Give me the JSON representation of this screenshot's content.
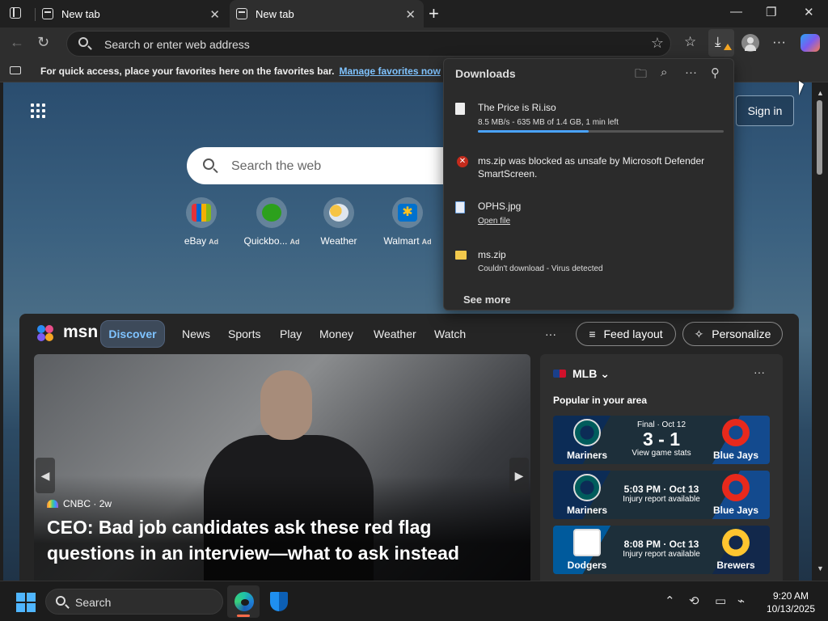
{
  "browser": {
    "tabs": [
      {
        "title": "New tab",
        "active": false
      },
      {
        "title": "New tab",
        "active": true
      }
    ],
    "new_tab_glyph": "+",
    "window_controls": {
      "minimize": "—",
      "maximize": "❐",
      "close": "✕"
    },
    "address_placeholder": "Search or enter web address",
    "toolbar_icons": [
      "favorites-star-icon",
      "collections-icon",
      "downloads-icon",
      "profile-icon",
      "more-icon",
      "copilot-icon"
    ]
  },
  "favorites_bar": {
    "message": "For quick access, place your favorites here on the favorites bar.",
    "link": "Manage favorites now"
  },
  "newtab": {
    "signin": "Sign in",
    "search_placeholder": "Search the web",
    "quick_links": [
      {
        "label": "eBay",
        "ad": "Ad",
        "color": "#e53238"
      },
      {
        "label": "Quickbo...",
        "ad": "Ad",
        "color": "#2ca01c"
      },
      {
        "label": "Weather",
        "ad": "",
        "color": "#f6c443"
      },
      {
        "label": "Walmart",
        "ad": "Ad",
        "color": "#0071ce"
      }
    ]
  },
  "downloads": {
    "title": "Downloads",
    "items": [
      {
        "name": "The Price is Ri.iso",
        "status": "8.5 MB/s - 635 MB of 1.4 GB, 1 min left",
        "progress": 0.45
      },
      {
        "name": "ms.zip was blocked as unsafe by Microsoft Defender SmartScreen.",
        "status": ""
      },
      {
        "name": "OPHS.jpg",
        "status": "Open file"
      },
      {
        "name": "ms.zip",
        "status": "Couldn't download - Virus detected"
      }
    ],
    "see_more": "See more"
  },
  "msn": {
    "logo": "msn",
    "nav": [
      "Discover",
      "News",
      "Sports",
      "Play",
      "Money",
      "Weather",
      "Watch"
    ],
    "more": "···",
    "feed_layout": "Feed layout",
    "personalize": "Personalize",
    "hero": {
      "source": "CNBC",
      "age": "· 2w",
      "headline": "CEO: Bad job candidates ask these red flag questions in an interview—what to ask instead"
    },
    "sports": {
      "league": "MLB",
      "subtitle": "Popular in your area",
      "games": [
        {
          "home": "Mariners",
          "away": "Blue Jays",
          "top": "Final · Oct 12",
          "main": "3 - 1",
          "bottom": "View game stats",
          "final": true
        },
        {
          "home": "Mariners",
          "away": "Blue Jays",
          "top": "5:03 PM · Oct 13",
          "main": "",
          "bottom": "Injury report available",
          "final": false
        },
        {
          "home": "Dodgers",
          "away": "Brewers",
          "top": "8:08 PM · Oct 13",
          "main": "",
          "bottom": "Injury report available",
          "final": false
        }
      ]
    }
  },
  "taskbar": {
    "search_placeholder": "Search",
    "time": "9:20 AM",
    "date": "10/13/2025"
  }
}
